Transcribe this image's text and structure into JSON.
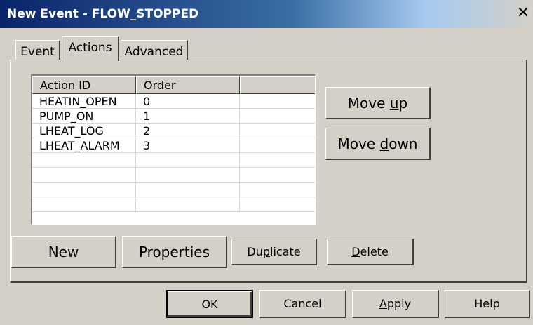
{
  "window": {
    "title": "New Event - FLOW_STOPPED",
    "close_glyph": "✕"
  },
  "tabs": [
    {
      "label": "Event"
    },
    {
      "label": "Actions"
    },
    {
      "label": "Advanced"
    }
  ],
  "list": {
    "columns": [
      "Action ID",
      "Order",
      ""
    ],
    "rows": [
      {
        "id": "HEATIN_OPEN",
        "order": "0"
      },
      {
        "id": "PUMP_ON",
        "order": "1"
      },
      {
        "id": "LHEAT_LOG",
        "order": "2"
      },
      {
        "id": "LHEAT_ALARM",
        "order": "3"
      }
    ]
  },
  "side_buttons": {
    "move_up": {
      "pre": "Move ",
      "key": "u",
      "post": "p"
    },
    "move_down": {
      "pre": "Move ",
      "key": "d",
      "post": "own"
    }
  },
  "action_buttons": {
    "new": "New",
    "properties": "Properties",
    "duplicate": {
      "pre": "Du",
      "key": "p",
      "post": "licate"
    },
    "delete": {
      "pre": "",
      "key": "D",
      "post": "elete"
    }
  },
  "dialog_buttons": {
    "ok": "OK",
    "cancel": "Cancel",
    "apply": {
      "pre": "",
      "key": "A",
      "post": "pply"
    },
    "help": "Help"
  }
}
